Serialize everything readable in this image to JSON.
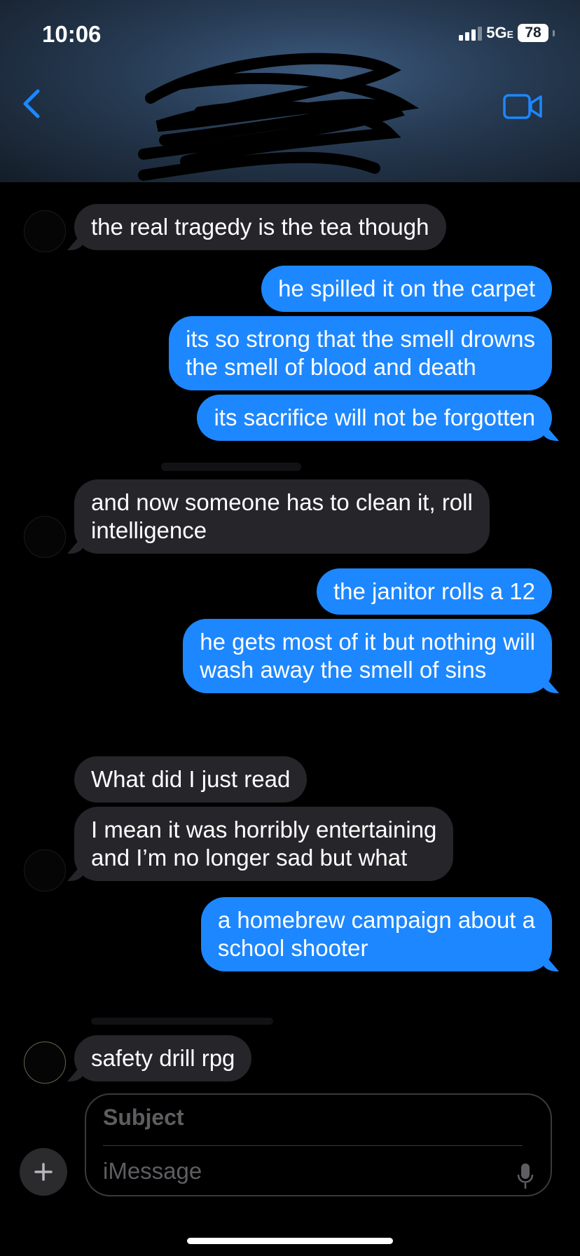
{
  "status_bar": {
    "time": "10:06",
    "network": "5G",
    "network_suffix": "E",
    "battery": "78"
  },
  "messages": [
    {
      "text": "the real tragedy is the tea though",
      "from": "them"
    },
    {
      "text": "he spilled it on the carpet",
      "from": "me"
    },
    {
      "text": "its so strong that the smell drowns\nthe smell of blood and death",
      "from": "me"
    },
    {
      "text": "its sacrifice will not be forgotten",
      "from": "me"
    },
    {
      "text": "and now someone has to clean it, roll\nintelligence",
      "from": "them"
    },
    {
      "text": "the janitor rolls a 12",
      "from": "me"
    },
    {
      "text": "he gets most of it but nothing will\nwash away the smell of sins",
      "from": "me"
    },
    {
      "text": "What did I just read",
      "from": "them"
    },
    {
      "text": " I mean it was horribly entertaining\nand I’m no longer sad but what",
      "from": "them"
    },
    {
      "text": "a homebrew campaign about a\nschool shooter",
      "from": "me"
    },
    {
      "text": "safety drill rpg",
      "from": "them"
    }
  ],
  "compose": {
    "subject_placeholder": "Subject",
    "message_placeholder": "iMessage"
  },
  "colors": {
    "outgoing": "#1d87ff",
    "incoming": "#26252a",
    "accent": "#1d87ff"
  },
  "icons": [
    "back-chevron-icon",
    "video-call-icon",
    "plus-icon",
    "microphone-icon"
  ]
}
